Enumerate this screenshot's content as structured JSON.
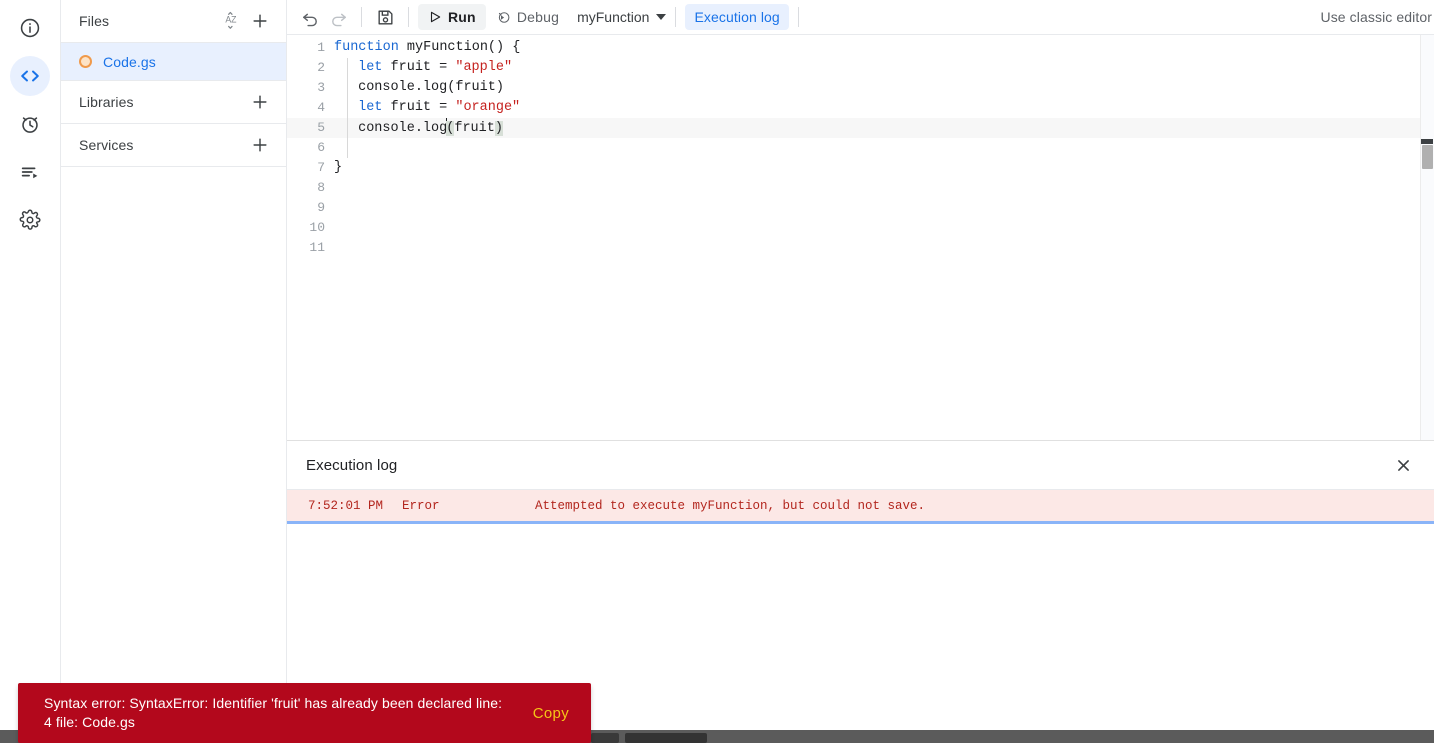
{
  "rail": {
    "items": [
      {
        "name": "overview-icon",
        "label": "Overview",
        "active": false
      },
      {
        "name": "code-editor-icon",
        "label": "Editor",
        "active": true
      },
      {
        "name": "triggers-clock-icon",
        "label": "Triggers",
        "active": false
      },
      {
        "name": "executions-list-icon",
        "label": "Executions",
        "active": false
      },
      {
        "name": "settings-gear-icon",
        "label": "Project Settings",
        "active": false
      }
    ]
  },
  "sidebar": {
    "files": {
      "title": "Files",
      "sort_icon": "sort-az-icon",
      "add_icon": "plus-icon",
      "items": [
        {
          "name": "Code.gs",
          "status_icon": "orange-circle-icon",
          "selected": true
        }
      ]
    },
    "libraries": {
      "title": "Libraries",
      "add_icon": "plus-icon"
    },
    "services": {
      "title": "Services",
      "add_icon": "plus-icon"
    }
  },
  "toolbar": {
    "undo_icon": "undo-icon",
    "redo_icon": "redo-icon",
    "save_icon": "save-floppy-icon",
    "run_label": "Run",
    "run_icon": "play-triangle-icon",
    "debug_label": "Debug",
    "debug_icon": "debug-bug-icon",
    "function_selected": "myFunction",
    "function_caret_icon": "caret-down-icon",
    "execution_log_label": "Execution log",
    "classic_editor_label": "Use classic editor"
  },
  "editor": {
    "lines": [
      {
        "num": "1",
        "text": "function myFunction() {"
      },
      {
        "num": "2",
        "text": "  let fruit = \"apple\""
      },
      {
        "num": "3",
        "text": "  console.log(fruit)"
      },
      {
        "num": "4",
        "text": "  let fruit = \"orange\""
      },
      {
        "num": "5",
        "text": "  console.log(fruit)"
      },
      {
        "num": "6",
        "text": ""
      },
      {
        "num": "7",
        "text": "}"
      },
      {
        "num": "8",
        "text": ""
      },
      {
        "num": "9",
        "text": ""
      },
      {
        "num": "10",
        "text": ""
      },
      {
        "num": "11",
        "text": ""
      }
    ],
    "active_line": "5",
    "tokens": {
      "kw_function": "function",
      "fn_name": " myFunction() {",
      "kw_let": "let",
      "let_fruit_eq": " fruit = ",
      "str_apple": "\"apple\"",
      "str_orange": "\"orange\"",
      "console_log": "console.log",
      "paren_open": "(",
      "ident_fruit": "fruit",
      "paren_close": ")",
      "brace_close": "}"
    }
  },
  "log": {
    "title": "Execution log",
    "close_icon": "close-x-icon",
    "entries": [
      {
        "time": "7:52:01 PM",
        "level": "Error",
        "message": "Attempted to execute myFunction, but could not save."
      }
    ]
  },
  "toast": {
    "message": "Syntax error: SyntaxError: Identifier 'fruit' has already been declared line: 4 file: Code.gs",
    "action_label": "Copy"
  },
  "colors": {
    "accent_blue": "#1a73e8",
    "selected_bg": "#e8f0fe",
    "error_red": "#b3081c",
    "log_error_bg": "#fce8e6",
    "log_error_text": "#b3261e",
    "toast_action": "#f5c518",
    "string_red": "#c5221f",
    "keyword_blue": "#1967d2"
  }
}
